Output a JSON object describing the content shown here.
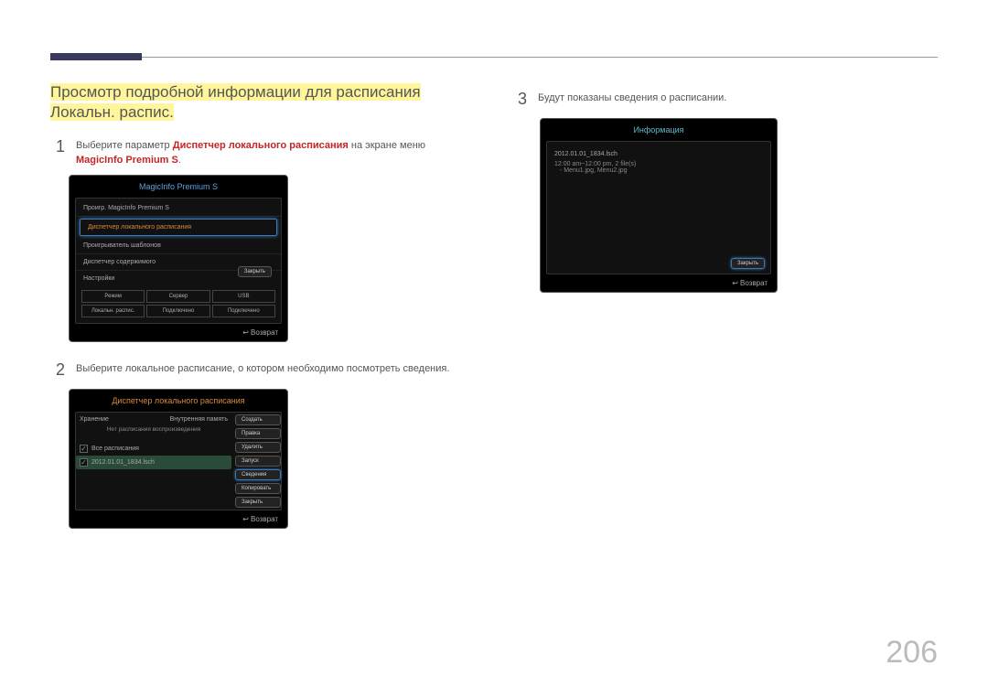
{
  "section_title": "Просмотр подробной информации для расписания Локальн. распис.",
  "page_number": "206",
  "steps": {
    "s1_num": "1",
    "s1_pre": "Выберите параметр ",
    "s1_red1": "Диспетчер локального расписания",
    "s1_mid": " на экране меню ",
    "s1_red2": "MagicInfo Premium S",
    "s1_post": ".",
    "s2_num": "2",
    "s2_txt": "Выберите локальное расписание, о котором необходимо посмотреть сведения.",
    "s3_num": "3",
    "s3_txt": "Будут показаны сведения о расписании."
  },
  "panel1": {
    "title": "MagicInfo Premium S",
    "items": [
      "Проигр. MagicInfo Premium S",
      "Диспетчер локального расписания",
      "Проигрыватель шаблонов",
      "Диспетчер содержимого",
      "Настройки"
    ],
    "close": "Закрыть",
    "grid_row1": [
      "Режим",
      "Сервер",
      "USB"
    ],
    "grid_row2": [
      "Локальн. распис.",
      "Подключено",
      "Подключено"
    ],
    "footer": "Возврат"
  },
  "panel2": {
    "title": "Диспетчер локального расписания",
    "storage_l": "Хранение",
    "storage_r": "Внутренняя память",
    "empty": "Нет расписания воспроизведения",
    "rowA": "Все расписания",
    "rowB": "2012.01.01_1834.lsch",
    "buttons": [
      "Создать",
      "Правка",
      "Удалить",
      "Запуск",
      "Сведения",
      "Копировать",
      "Закрыть"
    ],
    "sel_idx": 4,
    "footer": "Возврат"
  },
  "panel3": {
    "title": "Информация",
    "fname": "2012.01.01_1834.lsch",
    "line1": "12:00 am~12:00 pm, 2 file(s)",
    "line2": "- Menu1.jpg, Menu2.jpg",
    "close": "Закрыть",
    "footer": "Возврат"
  }
}
